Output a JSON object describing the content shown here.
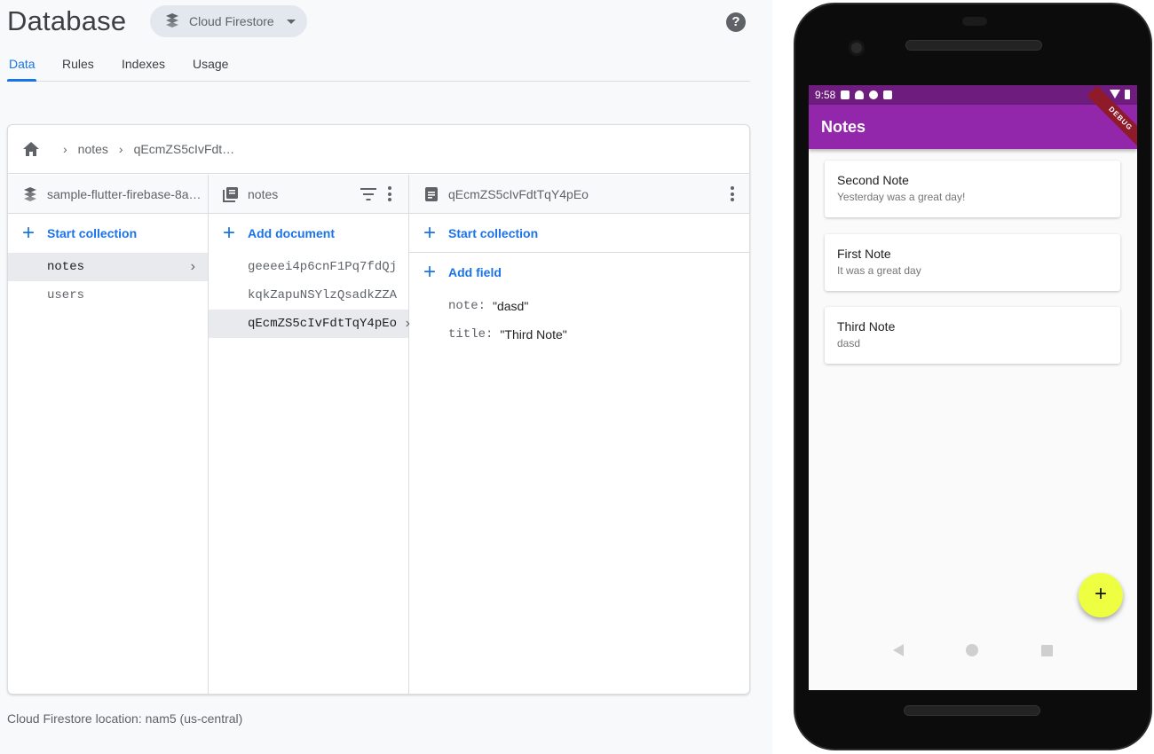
{
  "console": {
    "title": "Database",
    "product_selector": {
      "label": "Cloud Firestore"
    },
    "tabs": [
      {
        "label": "Data",
        "active": true
      },
      {
        "label": "Rules",
        "active": false
      },
      {
        "label": "Indexes",
        "active": false
      },
      {
        "label": "Usage",
        "active": false
      }
    ],
    "breadcrumb": [
      "notes",
      "qEcmZS5cIvFdt…"
    ],
    "columns": {
      "root": {
        "header": "sample-flutter-firebase-8a…",
        "action": "Start collection",
        "items": [
          {
            "label": "notes",
            "selected": true
          },
          {
            "label": "users",
            "selected": false
          }
        ]
      },
      "collection": {
        "header": "notes",
        "action": "Add document",
        "items": [
          {
            "label": "geeeei4p6cnF1Pq7fdQj",
            "selected": false
          },
          {
            "label": "kqkZapuNSYlzQsadkZZA",
            "selected": false
          },
          {
            "label": "qEcmZS5cIvFdtTqY4pEo",
            "selected": true
          }
        ]
      },
      "document": {
        "header": "qEcmZS5cIvFdtTqY4pEo",
        "action_collection": "Start collection",
        "action_field": "Add field",
        "fields": [
          {
            "key": "note:",
            "value": "\"dasd\""
          },
          {
            "key": "title:",
            "value": "\"Third Note\""
          }
        ]
      }
    },
    "location": "Cloud Firestore location: nam5 (us-central)"
  },
  "phone": {
    "status_time": "9:58",
    "app_title": "Notes",
    "debug_label": "DEBUG",
    "notes": [
      {
        "title": "Second Note",
        "subtitle": "Yesterday was a great day!"
      },
      {
        "title": "First Note",
        "subtitle": "It was a great day"
      },
      {
        "title": "Third Note",
        "subtitle": "dasd"
      }
    ],
    "fab_label": "+"
  },
  "colors": {
    "accent": "#1a73e8",
    "app_bar": "#9227ab",
    "status_bar": "#6e1c7e",
    "fab": "#eeff41"
  }
}
